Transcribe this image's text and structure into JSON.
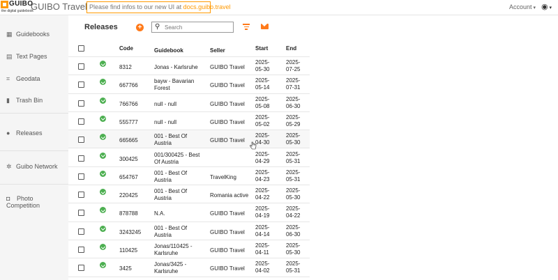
{
  "header": {
    "logo_text": "GUIBO",
    "logo_sub": "the digital guidebook",
    "app_title": "GUIBO Travel",
    "notice_prefix": "Please find infos to our new UI at",
    "notice_link": "docs.guibo.travel",
    "account_label": "Account"
  },
  "sidebar": {
    "items": [
      {
        "label": "Guidebooks",
        "icon": "grid-icon"
      },
      {
        "label": "Text Pages",
        "icon": "page-icon"
      },
      {
        "label": "Geodata",
        "icon": "map-icon"
      },
      {
        "label": "Trash Bin",
        "icon": "trash-icon"
      },
      {
        "label": "Releases",
        "icon": "release-icon"
      },
      {
        "label": "Guibo Network",
        "icon": "network-icon"
      },
      {
        "label": "Photo",
        "label2": "Competition",
        "icon": "camera-icon"
      }
    ]
  },
  "main": {
    "title": "Releases",
    "add_label": "+",
    "search_placeholder": "Search",
    "columns": {
      "code": "Code",
      "guidebook": "Guidebook",
      "seller": "Seller",
      "start": "Start",
      "end": "End"
    },
    "rows": [
      {
        "code": "8312",
        "guidebook": "Jonas - Karlsruhe",
        "seller": "GUIBO Travel",
        "start": "2025-05-30",
        "end": "2025-07-25"
      },
      {
        "code": "667766",
        "guidebook": "bayw - Bavarian Forest",
        "seller": "GUIBO Travel",
        "start": "2025-05-14",
        "end": "2025-07-31"
      },
      {
        "code": "766766",
        "guidebook": "null - null",
        "seller": "GUIBO Travel",
        "start": "2025-05-08",
        "end": "2025-06-30"
      },
      {
        "code": "555777",
        "guidebook": "null - null",
        "seller": "GUIBO Travel",
        "start": "2025-05-02",
        "end": "2025-05-29"
      },
      {
        "code": "665665",
        "guidebook": "001 - Best Of Austria",
        "seller": "GUIBO Travel",
        "start": "2025-04-30",
        "end": "2025-05-30"
      },
      {
        "code": "300425",
        "guidebook": "001/300425 - Best Of Austria",
        "seller": "",
        "start": "2025-04-29",
        "end": "2025-05-31"
      },
      {
        "code": "654767",
        "guidebook": "001 - Best Of Austria",
        "seller": "TravelKing",
        "start": "2025-04-23",
        "end": "2025-05-31"
      },
      {
        "code": "220425",
        "guidebook": "001 - Best Of Austria",
        "seller": "Romania active",
        "start": "2025-04-22",
        "end": "2025-05-30"
      },
      {
        "code": "878788",
        "guidebook": "N.A.",
        "seller": "GUIBO Travel",
        "start": "2025-04-19",
        "end": "2025-04-22"
      },
      {
        "code": "3243245",
        "guidebook": "001 - Best Of Austria",
        "seller": "GUIBO Travel",
        "start": "2025-04-14",
        "end": "2025-06-30"
      },
      {
        "code": "110425",
        "guidebook": "Jonas/110425 - Karlsruhe",
        "seller": "GUIBO Travel",
        "start": "2025-04-11",
        "end": "2025-05-30"
      },
      {
        "code": "3425",
        "guidebook": "Jonas/3425 - Karlsruhe",
        "seller": "GUIBO Travel",
        "start": "2025-04-02",
        "end": "2025-05-31"
      }
    ]
  },
  "colors": {
    "accent": "#ff7a1a",
    "logo": "#ff9900",
    "status_ok": "#4caf50",
    "sidebar_bg": "#f5f5f5"
  }
}
